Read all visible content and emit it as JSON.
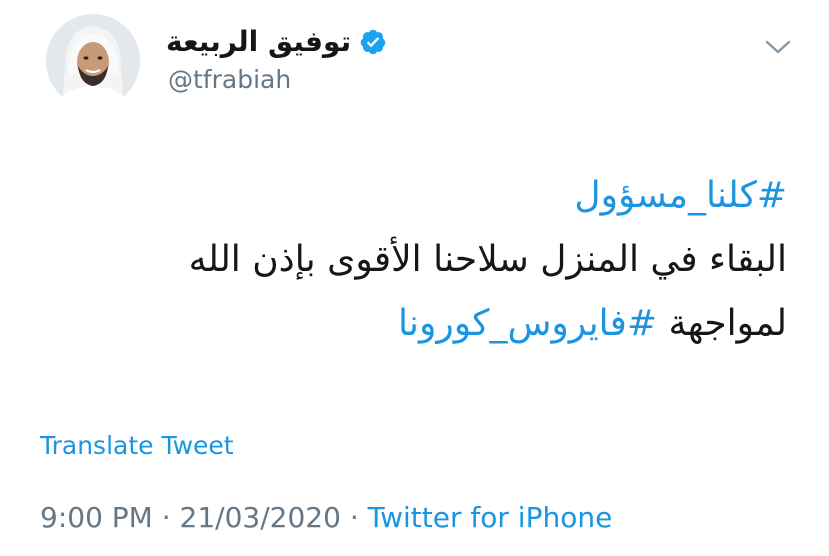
{
  "tweet": {
    "author": {
      "display_name": "توفيق الربيعة",
      "handle": "@tfrabiah",
      "verified": true
    },
    "text_lines": [
      {
        "hashtag": "#كلنا_مسؤول"
      },
      {
        "text": "البقاء في المنزل سلاحنا الأقوى بإذن الله"
      },
      {
        "text": "لمواجهة ",
        "hashtag": "#فايروس_كورونا"
      }
    ],
    "translate_label": "Translate Tweet",
    "time": "9:00 PM",
    "date": "21/03/2020",
    "separator": "·",
    "source": "Twitter for iPhone"
  },
  "icons": {
    "verified": "verified-badge-icon",
    "menu": "chevron-down-icon"
  },
  "colors": {
    "link": "#1b95e0",
    "secondary_text": "#657786",
    "primary_text": "#14171a",
    "verified": "#1da1f2"
  }
}
